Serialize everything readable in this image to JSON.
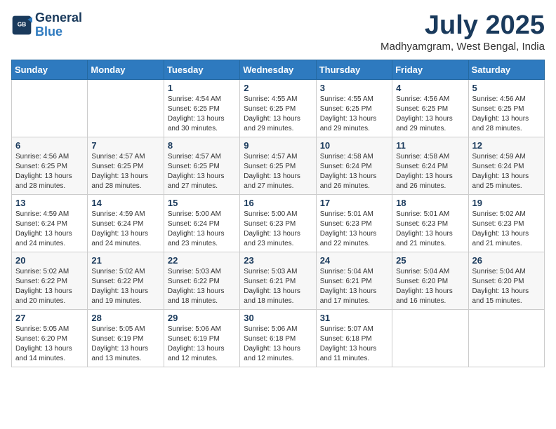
{
  "logo": {
    "line1": "General",
    "line2": "Blue"
  },
  "title": "July 2025",
  "location": "Madhyamgram, West Bengal, India",
  "weekdays": [
    "Sunday",
    "Monday",
    "Tuesday",
    "Wednesday",
    "Thursday",
    "Friday",
    "Saturday"
  ],
  "weeks": [
    [
      {
        "day": "",
        "info": ""
      },
      {
        "day": "",
        "info": ""
      },
      {
        "day": "1",
        "info": "Sunrise: 4:54 AM\nSunset: 6:25 PM\nDaylight: 13 hours and 30 minutes."
      },
      {
        "day": "2",
        "info": "Sunrise: 4:55 AM\nSunset: 6:25 PM\nDaylight: 13 hours and 29 minutes."
      },
      {
        "day": "3",
        "info": "Sunrise: 4:55 AM\nSunset: 6:25 PM\nDaylight: 13 hours and 29 minutes."
      },
      {
        "day": "4",
        "info": "Sunrise: 4:56 AM\nSunset: 6:25 PM\nDaylight: 13 hours and 29 minutes."
      },
      {
        "day": "5",
        "info": "Sunrise: 4:56 AM\nSunset: 6:25 PM\nDaylight: 13 hours and 28 minutes."
      }
    ],
    [
      {
        "day": "6",
        "info": "Sunrise: 4:56 AM\nSunset: 6:25 PM\nDaylight: 13 hours and 28 minutes."
      },
      {
        "day": "7",
        "info": "Sunrise: 4:57 AM\nSunset: 6:25 PM\nDaylight: 13 hours and 28 minutes."
      },
      {
        "day": "8",
        "info": "Sunrise: 4:57 AM\nSunset: 6:25 PM\nDaylight: 13 hours and 27 minutes."
      },
      {
        "day": "9",
        "info": "Sunrise: 4:57 AM\nSunset: 6:25 PM\nDaylight: 13 hours and 27 minutes."
      },
      {
        "day": "10",
        "info": "Sunrise: 4:58 AM\nSunset: 6:24 PM\nDaylight: 13 hours and 26 minutes."
      },
      {
        "day": "11",
        "info": "Sunrise: 4:58 AM\nSunset: 6:24 PM\nDaylight: 13 hours and 26 minutes."
      },
      {
        "day": "12",
        "info": "Sunrise: 4:59 AM\nSunset: 6:24 PM\nDaylight: 13 hours and 25 minutes."
      }
    ],
    [
      {
        "day": "13",
        "info": "Sunrise: 4:59 AM\nSunset: 6:24 PM\nDaylight: 13 hours and 24 minutes."
      },
      {
        "day": "14",
        "info": "Sunrise: 4:59 AM\nSunset: 6:24 PM\nDaylight: 13 hours and 24 minutes."
      },
      {
        "day": "15",
        "info": "Sunrise: 5:00 AM\nSunset: 6:24 PM\nDaylight: 13 hours and 23 minutes."
      },
      {
        "day": "16",
        "info": "Sunrise: 5:00 AM\nSunset: 6:23 PM\nDaylight: 13 hours and 23 minutes."
      },
      {
        "day": "17",
        "info": "Sunrise: 5:01 AM\nSunset: 6:23 PM\nDaylight: 13 hours and 22 minutes."
      },
      {
        "day": "18",
        "info": "Sunrise: 5:01 AM\nSunset: 6:23 PM\nDaylight: 13 hours and 21 minutes."
      },
      {
        "day": "19",
        "info": "Sunrise: 5:02 AM\nSunset: 6:23 PM\nDaylight: 13 hours and 21 minutes."
      }
    ],
    [
      {
        "day": "20",
        "info": "Sunrise: 5:02 AM\nSunset: 6:22 PM\nDaylight: 13 hours and 20 minutes."
      },
      {
        "day": "21",
        "info": "Sunrise: 5:02 AM\nSunset: 6:22 PM\nDaylight: 13 hours and 19 minutes."
      },
      {
        "day": "22",
        "info": "Sunrise: 5:03 AM\nSunset: 6:22 PM\nDaylight: 13 hours and 18 minutes."
      },
      {
        "day": "23",
        "info": "Sunrise: 5:03 AM\nSunset: 6:21 PM\nDaylight: 13 hours and 18 minutes."
      },
      {
        "day": "24",
        "info": "Sunrise: 5:04 AM\nSunset: 6:21 PM\nDaylight: 13 hours and 17 minutes."
      },
      {
        "day": "25",
        "info": "Sunrise: 5:04 AM\nSunset: 6:20 PM\nDaylight: 13 hours and 16 minutes."
      },
      {
        "day": "26",
        "info": "Sunrise: 5:04 AM\nSunset: 6:20 PM\nDaylight: 13 hours and 15 minutes."
      }
    ],
    [
      {
        "day": "27",
        "info": "Sunrise: 5:05 AM\nSunset: 6:20 PM\nDaylight: 13 hours and 14 minutes."
      },
      {
        "day": "28",
        "info": "Sunrise: 5:05 AM\nSunset: 6:19 PM\nDaylight: 13 hours and 13 minutes."
      },
      {
        "day": "29",
        "info": "Sunrise: 5:06 AM\nSunset: 6:19 PM\nDaylight: 13 hours and 12 minutes."
      },
      {
        "day": "30",
        "info": "Sunrise: 5:06 AM\nSunset: 6:18 PM\nDaylight: 13 hours and 12 minutes."
      },
      {
        "day": "31",
        "info": "Sunrise: 5:07 AM\nSunset: 6:18 PM\nDaylight: 13 hours and 11 minutes."
      },
      {
        "day": "",
        "info": ""
      },
      {
        "day": "",
        "info": ""
      }
    ]
  ]
}
